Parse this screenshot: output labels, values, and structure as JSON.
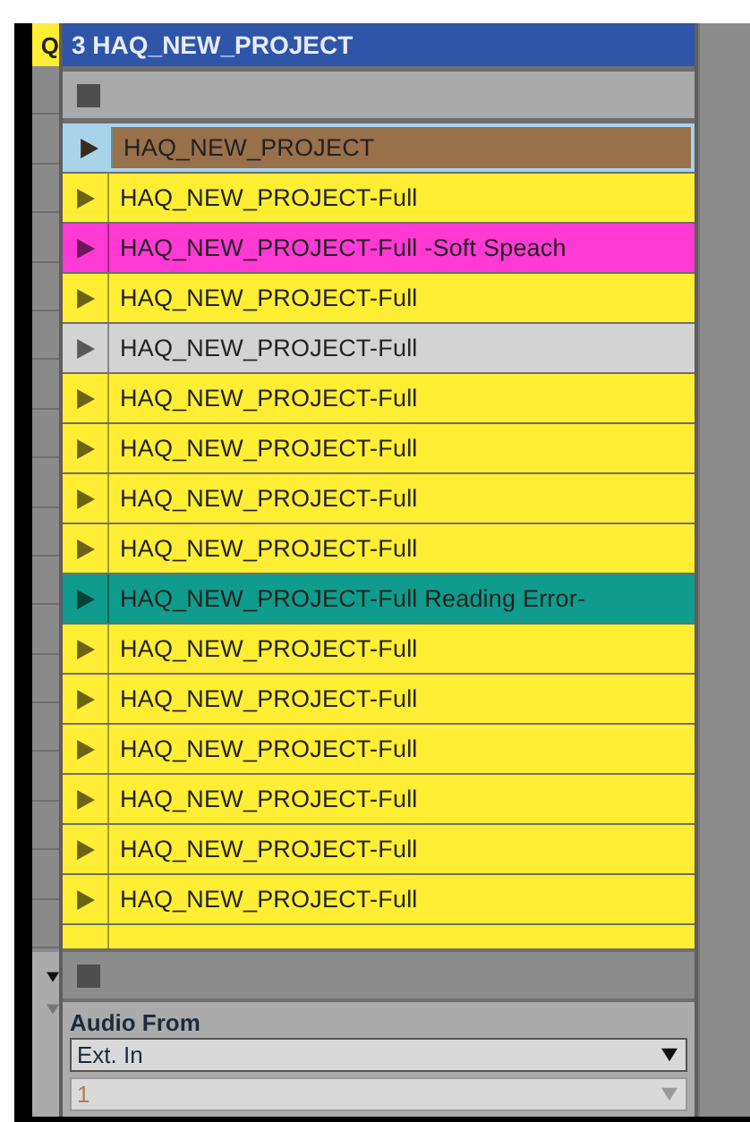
{
  "previous_track": {
    "title": "Q"
  },
  "track": {
    "title": "3 HAQ_NEW_PROJECT",
    "clips": [
      {
        "name": "HAQ_NEW_PROJECT",
        "color": "#98704a",
        "selected": true
      },
      {
        "name": "HAQ_NEW_PROJECT-Full",
        "color": "#ffee33",
        "selected": false
      },
      {
        "name": "HAQ_NEW_PROJECT-Full -Soft Speach",
        "color": "#ff3ad4",
        "selected": false
      },
      {
        "name": "HAQ_NEW_PROJECT-Full",
        "color": "#ffee33",
        "selected": false
      },
      {
        "name": "HAQ_NEW_PROJECT-Full",
        "color": "#d3d3d3",
        "selected": false
      },
      {
        "name": "HAQ_NEW_PROJECT-Full",
        "color": "#ffee33",
        "selected": false
      },
      {
        "name": "HAQ_NEW_PROJECT-Full",
        "color": "#ffee33",
        "selected": false
      },
      {
        "name": "HAQ_NEW_PROJECT-Full",
        "color": "#ffee33",
        "selected": false
      },
      {
        "name": "HAQ_NEW_PROJECT-Full",
        "color": "#ffee33",
        "selected": false
      },
      {
        "name": "HAQ_NEW_PROJECT-Full Reading Error-",
        "color": "#0f9c8c",
        "selected": false
      },
      {
        "name": "HAQ_NEW_PROJECT-Full",
        "color": "#ffee33",
        "selected": false
      },
      {
        "name": "HAQ_NEW_PROJECT-Full",
        "color": "#ffee33",
        "selected": false
      },
      {
        "name": "HAQ_NEW_PROJECT-Full",
        "color": "#ffee33",
        "selected": false
      },
      {
        "name": "HAQ_NEW_PROJECT-Full",
        "color": "#ffee33",
        "selected": false
      },
      {
        "name": "HAQ_NEW_PROJECT-Full",
        "color": "#ffee33",
        "selected": false
      },
      {
        "name": "HAQ_NEW_PROJECT-Full",
        "color": "#ffee33",
        "selected": false
      },
      {
        "color": "#ffee33",
        "selected": false
      }
    ],
    "audio_from": {
      "label": "Audio From",
      "input": {
        "value": "Ext. In",
        "disabled": false
      },
      "channel": {
        "value": "1",
        "disabled": true
      }
    }
  }
}
